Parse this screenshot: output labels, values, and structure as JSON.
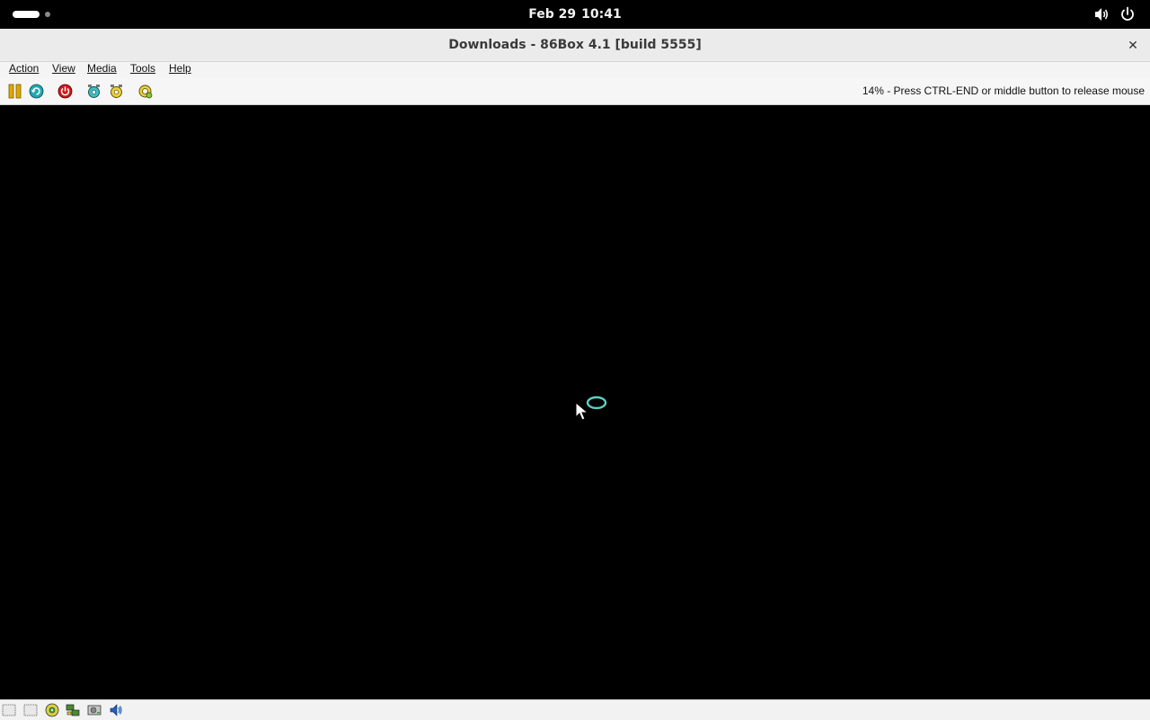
{
  "system_bar": {
    "date": "Feb 29",
    "time": "10:41",
    "icons": [
      "activities-indicator",
      "volume-icon",
      "power-icon"
    ]
  },
  "window": {
    "title": "Downloads - 86Box 4.1 [build 5555]",
    "close_label": "✕"
  },
  "menu": {
    "items": [
      "Action",
      "View",
      "Media",
      "Tools",
      "Help"
    ]
  },
  "toolbar": {
    "buttons": [
      "pause-icon",
      "hard-reset-icon",
      "power-off-icon",
      "ctrl-alt-del-icon",
      "ctrl-alt-esc-icon",
      "settings-icon"
    ],
    "status_message": "14% - Press CTRL-END or middle button to release mouse"
  },
  "statusbar": {
    "icons": [
      "floppy-drive-1-icon",
      "floppy-drive-2-icon",
      "cdrom-icon",
      "network-icon",
      "hard-disk-icon",
      "sound-icon"
    ]
  },
  "colors": {
    "screen_background": "#000000",
    "chrome_background": "#ebebeb",
    "spinner": "#5fd0c0"
  }
}
